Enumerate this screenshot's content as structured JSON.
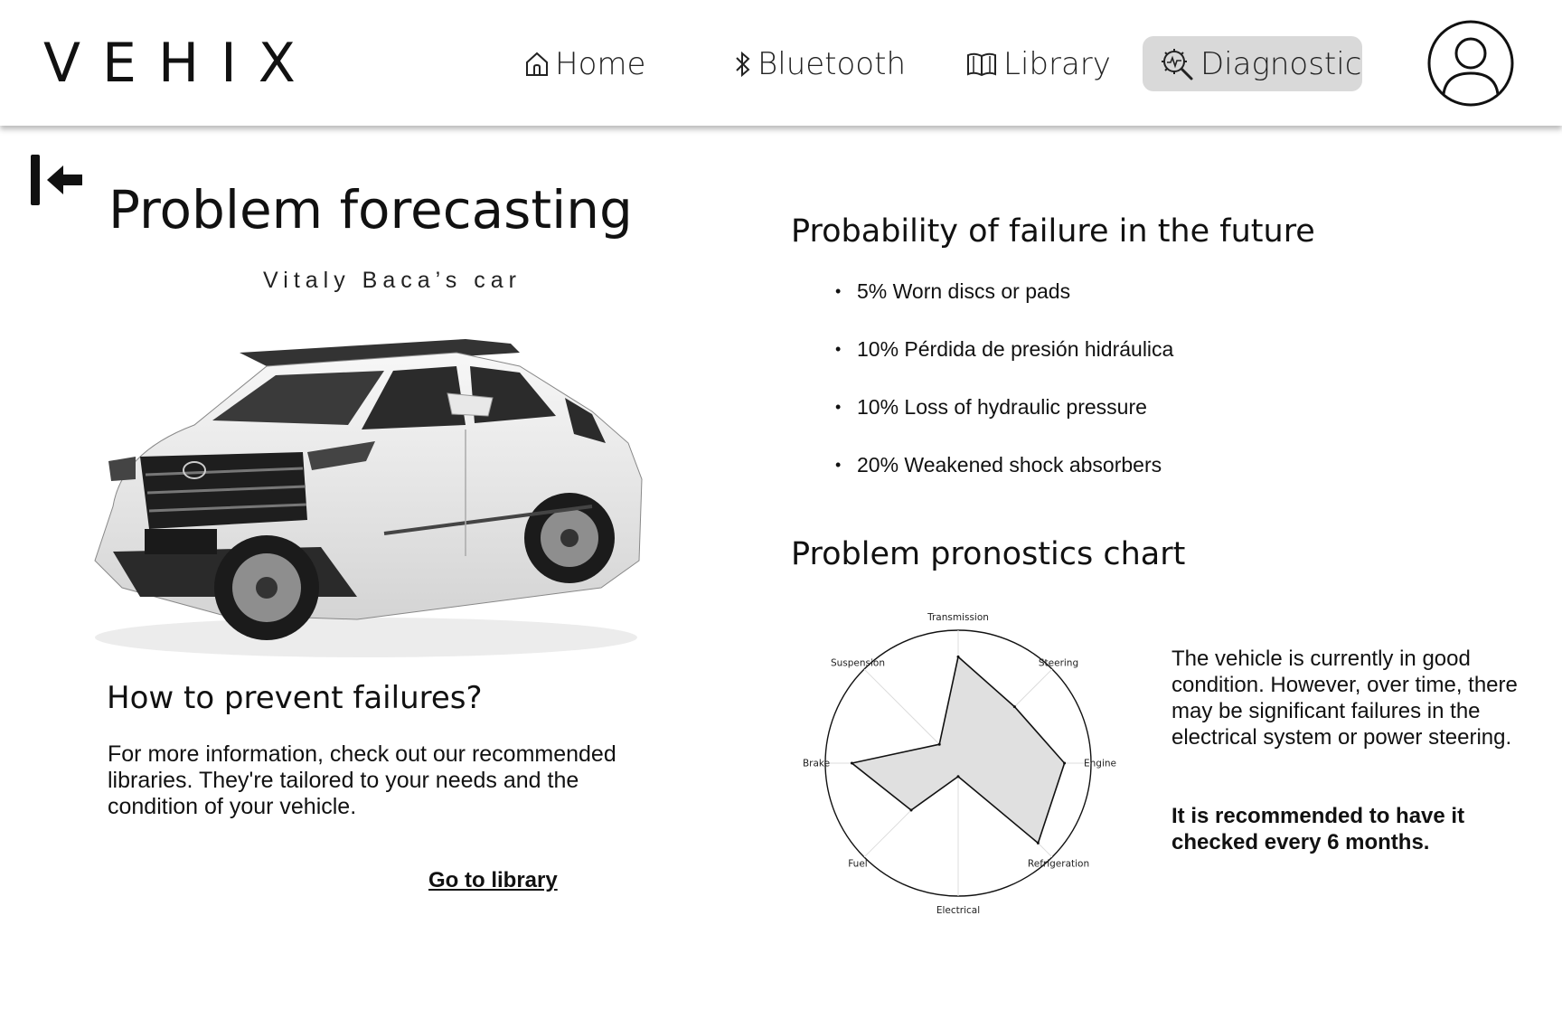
{
  "header": {
    "logo": "VEHIX",
    "nav": [
      {
        "label": "Home",
        "icon": "home-icon"
      },
      {
        "label": "Bluetooth",
        "icon": "bluetooth-icon"
      },
      {
        "label": "Library",
        "icon": "book-icon"
      },
      {
        "label": "Diagnostic",
        "icon": "diagnostic-icon",
        "active": true
      }
    ],
    "avatar_icon": "user-avatar-icon"
  },
  "main": {
    "back_icon": "collapse-left-arrow-icon",
    "title": "Problem forecasting",
    "owner": "Vitaly Baca’s car",
    "car_image": "white SUV photo",
    "prevent": {
      "title": "How to prevent failures?",
      "text": "For more information, check out our recommended libraries. They're tailored to your needs and the condition of your vehicle.",
      "link": "Go to library"
    }
  },
  "probabilities": {
    "title": "Probability of failure in the future",
    "items": [
      "5% Worn discs or pads",
      "10% Pérdida de presión hidráulica",
      "10% Loss of hydraulic pressure",
      "20% Weakened shock absorbers"
    ]
  },
  "pronostics": {
    "title": "Problem pronostics chart",
    "summary": "The vehicle is currently in good condition. However, over time, there may be significant failures in the electrical system or power steering.",
    "recommendation": "It is recommended to have it checked every 6 months."
  },
  "chart_data": {
    "type": "radar",
    "categories": [
      "Transmission",
      "Steering",
      "Engine",
      "Refrigeration",
      "Electrical",
      "Fuel",
      "Brake",
      "Suspension"
    ],
    "values": [
      0.8,
      0.6,
      0.8,
      0.85,
      0.1,
      0.5,
      0.8,
      0.2
    ],
    "range": [
      0,
      1
    ],
    "fill_color": "#e0e0e0",
    "line_color": "#111111",
    "grid": true
  },
  "colors": {
    "active_nav_bg": "#d9d9d9",
    "text": "#111111",
    "background": "#ffffff"
  }
}
